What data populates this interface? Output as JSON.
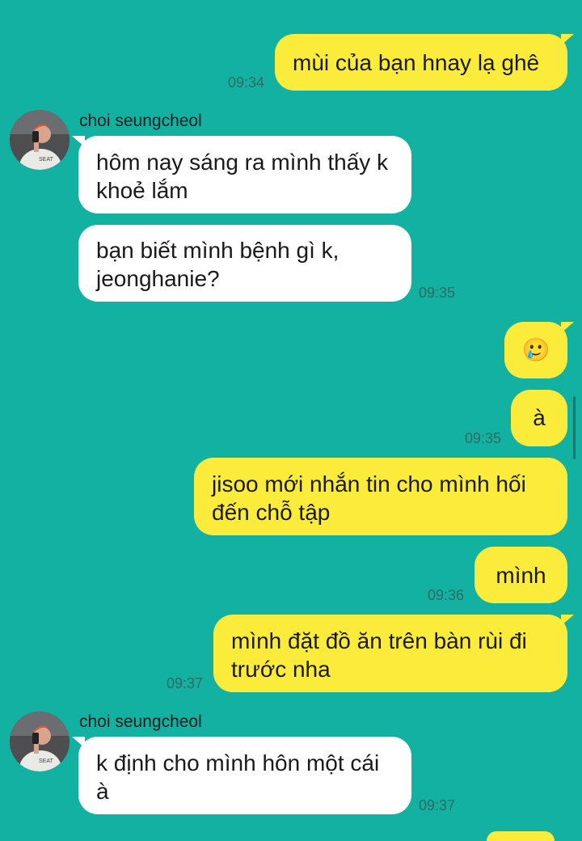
{
  "contact": {
    "name": "choi seungcheol",
    "avatar_icon": "user-avatar-photo"
  },
  "colors": {
    "background": "#13b1a1",
    "outgoing_bubble": "#fbec3c",
    "incoming_bubble": "#ffffff"
  },
  "messages": [
    {
      "direction": "outgoing",
      "text": "mùi của bạn hnay lạ ghê",
      "time": "09:34"
    },
    {
      "direction": "incoming",
      "sender": "choi seungcheol",
      "text": "hôm nay sáng ra mình thấy k khoẻ lắm"
    },
    {
      "direction": "incoming",
      "text": "bạn biết mình bệnh gì k, jeonghanie?",
      "time": "09:35"
    },
    {
      "direction": "outgoing",
      "text": "🥲"
    },
    {
      "direction": "outgoing",
      "text": "à",
      "time": "09:35"
    },
    {
      "direction": "outgoing",
      "text": "jisoo mới nhắn tin cho mình hối đến chỗ tập"
    },
    {
      "direction": "outgoing",
      "text": "mình",
      "time": "09:36"
    },
    {
      "direction": "outgoing",
      "text": "mình đặt đồ ăn trên bàn rùi đi trước nha",
      "time": "09:37"
    },
    {
      "direction": "incoming",
      "sender": "choi seungcheol",
      "text": "k định cho mình hôn một cái à",
      "time": "09:37"
    }
  ]
}
